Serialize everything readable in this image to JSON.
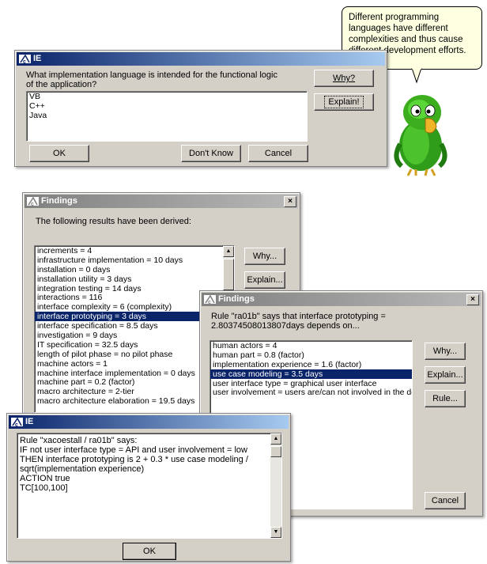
{
  "tooltip": {
    "text": "Different programming languages have different complexities and thus cause different development efforts."
  },
  "dialog1": {
    "title": "IE",
    "question": "What implementation language is intended for the functional logic of the application?",
    "options": [
      "VB",
      "C++",
      "Java"
    ],
    "why_label": "Why?",
    "explain_label": "Explain!",
    "ok_label": "OK",
    "dontknow_label": "Don't Know",
    "cancel_label": "Cancel"
  },
  "findings1": {
    "title": "Findings",
    "close_label": "×",
    "heading": "The following results have been derived:",
    "items": [
      "increments = 4",
      "infrastructure implementation = 10 days",
      "installation = 0 days",
      "installation utility = 3 days",
      "integration testing = 14 days",
      "interactions = 116",
      "interface complexity = 6 (complexity)",
      "interface prototyping = 3 days",
      "interface specification = 8.5 days",
      "investigation = 9 days",
      "IT specification = 32.5 days",
      "length of pilot phase = no pilot phase",
      "machine actors = 1",
      "machine interface implementation = 0 days",
      "machine part = 0.2 (factor)",
      "macro architecture = 2-tier",
      "macro architecture elaboration = 19.5 days"
    ],
    "selected_index": 7,
    "why_label": "Why...",
    "explain_label": "Explain..."
  },
  "findings2": {
    "title": "Findings",
    "close_label": "×",
    "heading": "Rule \"ra01b\" says that interface prototyping = 2.80374508013807days depends on...",
    "items": [
      "human actors = 4",
      "human part = 0.8 (factor)",
      "implementation experience = 1.6 (factor)",
      "use case modeling = 3.5 days",
      "user interface type = graphical user interface",
      "user involvement = users are/can not involved in the de"
    ],
    "selected_index": 3,
    "why_label": "Why...",
    "explain_label": "Explain...",
    "rule_label": "Rule...",
    "cancel_label": "Cancel"
  },
  "dialog2": {
    "title": "IE",
    "rule_lines": [
      "Rule \"xacoestall / ra01b\" says:",
      "IF not user interface type = API and user involvement = low",
      "THEN interface prototyping is 2 + 0.3 * use case modeling /",
      "sqrt(implementation experience)",
      "ACTION true",
      "TC[100,100]"
    ],
    "ok_label": "OK"
  },
  "colors": {
    "selection": "#0a246a",
    "active_title": "#0a246a",
    "inactive_title": "#808080",
    "parrot_green": "#3cae1e",
    "tooltip_bg": "#ffffe1"
  }
}
